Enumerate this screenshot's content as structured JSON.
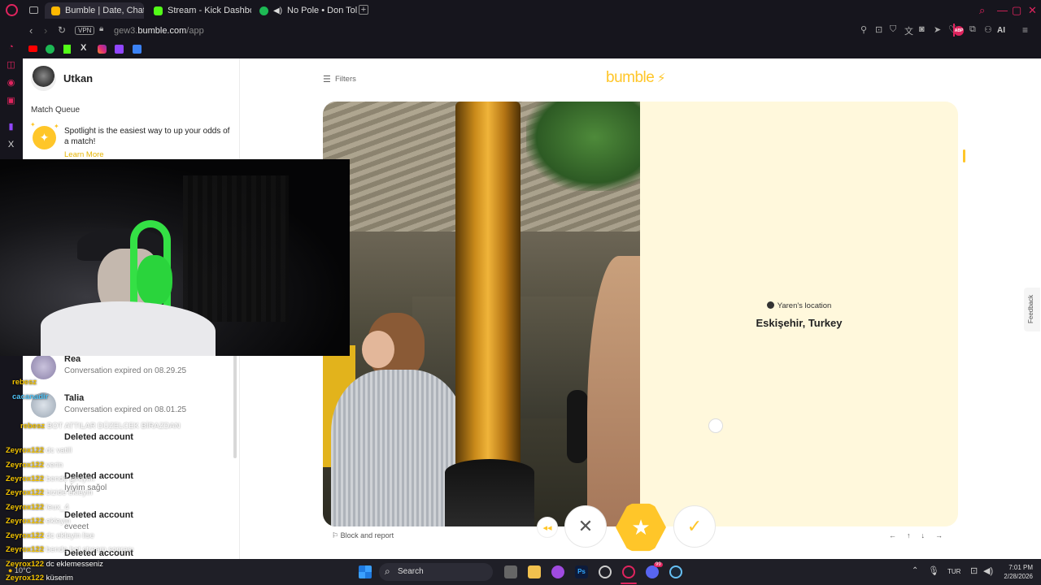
{
  "browser": {
    "tabs": [
      {
        "label": "Bumble | Date, Chat, Meet",
        "color": "#ffb800"
      },
      {
        "label": "Stream - Kick Dashboard",
        "color": "#53fc18"
      },
      {
        "label": "No Pole • Don Toliver",
        "color": "#1db954"
      }
    ],
    "vpn_label": "VPN",
    "url_prefix": "gew3.",
    "url_host": "bumble.com",
    "url_path": "/app",
    "ai_label": "AI",
    "abp_label": "ABP"
  },
  "sidebar": {
    "user_name": "Utkan",
    "match_queue_label": "Match Queue",
    "spotlight_text": "Spotlight is the easiest way to up your odds of a match!",
    "learn_more": "Learn More",
    "conversations": [
      {
        "name": "Rea",
        "status": "Conversation expired on 08.29.25"
      },
      {
        "name": "Talia",
        "status": "Conversation expired on 08.01.25"
      },
      {
        "name": "Deleted account",
        "status": ""
      },
      {
        "name": "Deleted account",
        "status": "İyiyim sağol"
      },
      {
        "name": "Deleted account",
        "status": "eveeet"
      },
      {
        "name": "Deleted account",
        "status": ""
      }
    ]
  },
  "main": {
    "filters_label": "Filters",
    "logo_text": "bumble",
    "location_label": "Yaren's location",
    "location_value": "Eskişehir, Turkey",
    "block_report": "Block and report",
    "feedback_label": "Feedback",
    "nav_keys": [
      "←",
      "↑",
      "↓",
      "→"
    ]
  },
  "chat": [
    {
      "user": "rebesz",
      "text": ""
    },
    {
      "user": "cacanadir",
      "text": ""
    },
    {
      "user": "rebesz",
      "text": "BOT ATTILAR DÜZELCEK BİRAZDAN"
    },
    {
      "user": "Zeyrox122",
      "text": "dc vatill"
    },
    {
      "user": "Zeyrox122",
      "text": "verin"
    },
    {
      "user": "Zeyrox122",
      "text": "bende gireyim"
    },
    {
      "user": "Zeyrox122",
      "text": "bizide ekleyin"
    },
    {
      "user": "Zeyrox122",
      "text": "leux_4"
    },
    {
      "user": "Zeyrox122",
      "text": "ekleyin"
    },
    {
      "user": "Zeyrox122",
      "text": "dc ekleyin lise"
    },
    {
      "user": "Zeyrox122",
      "text": "bende bot stream sonrası"
    },
    {
      "user": "Zeyrox122",
      "text": "dc eklemesseniz"
    },
    {
      "user": "Zeyrox122",
      "text": "küserim"
    }
  ],
  "taskbar": {
    "search_label": "Search",
    "weather": "10°C",
    "lang": "TUR",
    "time": "7:01 PM",
    "date": "2/28/2026",
    "discord_badge": "99"
  },
  "colors": {
    "bumble_yellow": "#ffc629",
    "info_panel_bg": "#fff8dc",
    "opera_red": "#e0245e",
    "chat_username": "#f2c200"
  }
}
